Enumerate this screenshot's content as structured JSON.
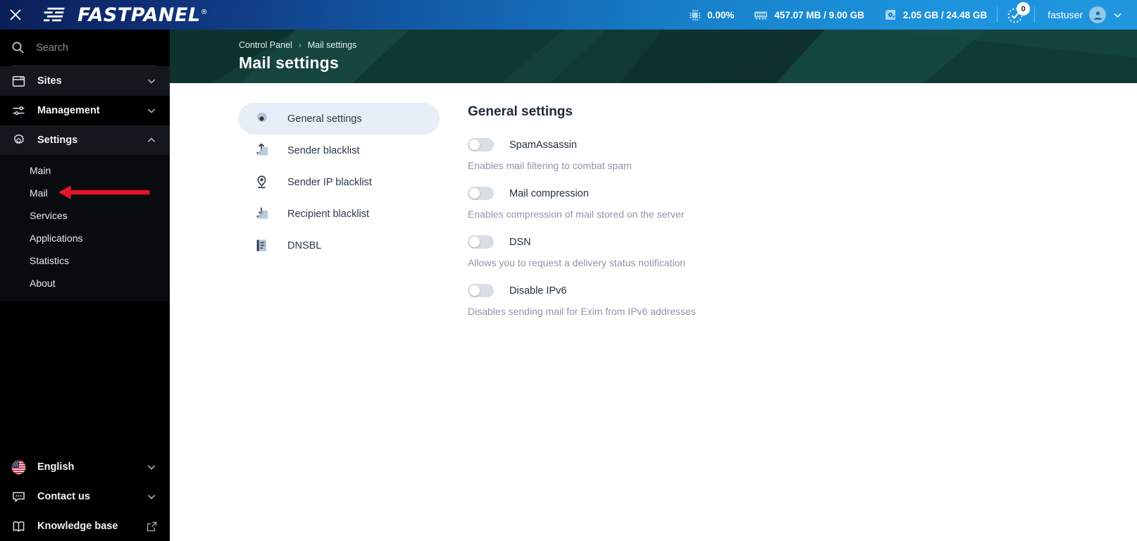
{
  "topbar": {
    "close_icon": "close-icon",
    "brand": "FASTPANEL",
    "brand_reg": "®",
    "cpu": {
      "icon": "cpu-icon",
      "value": "0.00%"
    },
    "ram": {
      "icon": "memory-icon",
      "value": "457.07 MB / 9.00 GB"
    },
    "disk": {
      "icon": "disk-icon",
      "value": "2.05 GB / 24.48 GB"
    },
    "tasks": {
      "icon": "tasks-check-icon",
      "badge": "0"
    },
    "user": {
      "name": "fastuser",
      "avatar_icon": "user-avatar-icon",
      "chevron_icon": "chevron-down-icon"
    }
  },
  "sidebar": {
    "search": {
      "placeholder": "Search",
      "value": "",
      "icon": "search-icon"
    },
    "groups": [
      {
        "label": "Sites",
        "icon": "window-icon",
        "chevron": "chevron-down-icon",
        "expanded": false
      },
      {
        "label": "Management",
        "icon": "sliders-icon",
        "chevron": "chevron-down-icon",
        "expanded": false
      },
      {
        "label": "Settings",
        "icon": "gear-icon",
        "chevron": "chevron-up-icon",
        "expanded": true
      }
    ],
    "settings_submenu": [
      {
        "label": "Main"
      },
      {
        "label": "Mail"
      },
      {
        "label": "Services"
      },
      {
        "label": "Applications"
      },
      {
        "label": "Statistics"
      },
      {
        "label": "About"
      }
    ],
    "bottom": [
      {
        "label": "English",
        "icon": "us-flag-icon",
        "trailing": "chevron-down-icon"
      },
      {
        "label": "Contact us",
        "icon": "chat-bubble-icon",
        "trailing": "chevron-down-icon"
      },
      {
        "label": "Knowledge base",
        "icon": "open-book-icon",
        "trailing": "external-link-icon"
      }
    ]
  },
  "header": {
    "breadcrumb": [
      "Control Panel",
      "Mail settings"
    ],
    "breadcrumb_separator": "›",
    "title": "Mail settings"
  },
  "inner_nav": [
    {
      "label": "General settings",
      "icon": "gear-icon",
      "active": true
    },
    {
      "label": "Sender blacklist",
      "icon": "upload-icon",
      "active": false
    },
    {
      "label": "Sender IP blacklist",
      "icon": "map-pin-icon",
      "active": false
    },
    {
      "label": "Recipient blacklist",
      "icon": "download-icon",
      "active": false
    },
    {
      "label": "DNSBL",
      "icon": "list-document-icon",
      "active": false
    }
  ],
  "panel": {
    "title": "General settings",
    "settings": [
      {
        "label": "SpamAssassin",
        "description": "Enables mail filtering to combat spam",
        "enabled": false
      },
      {
        "label": "Mail compression",
        "description": "Enables compression of mail stored on the server",
        "enabled": false
      },
      {
        "label": "DSN",
        "description": "Allows you to request a delivery status notification",
        "enabled": false
      },
      {
        "label": "Disable IPv6",
        "description": "Disables sending mail for Exim from IPv6 addresses",
        "enabled": false
      }
    ]
  },
  "annotation": {
    "type": "left-arrow",
    "color": "#e8152a",
    "target": "Mail"
  },
  "colors": {
    "topbar_start": "#0a1f57",
    "topbar_end": "#2096df",
    "sidebar_bg": "#000000",
    "header_bg": "#123c38",
    "active_pill": "#e7eef7",
    "switch_off": "#d8dde6",
    "annotation_red": "#e8152a"
  }
}
